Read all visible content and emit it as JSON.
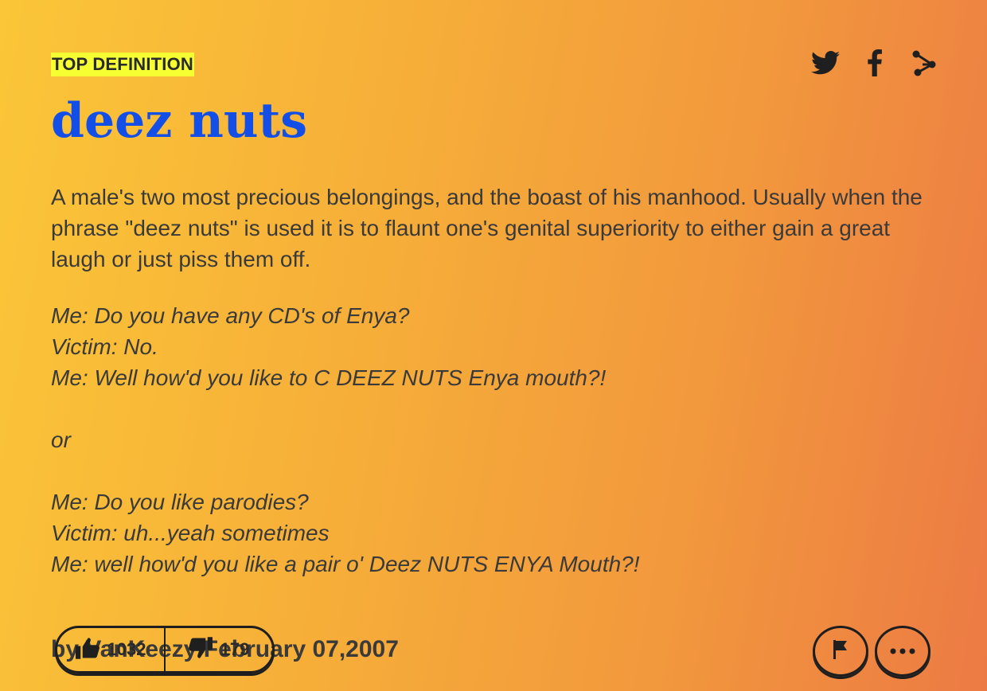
{
  "entry": {
    "badge": "TOP DEFINITION",
    "word": "deez nuts",
    "meaning": "A male's two most precious belongings, and the boast of his manhood. Usually when the phrase \"deez nuts\" is used it is to flaunt one's genital superiority to either gain a great laugh or just piss them off.",
    "example_lines": [
      "Me: Do you have any CD's of Enya?",
      "Victim: No.",
      "Me: Well how'd you like to C DEEZ NUTS Enya mouth?!",
      "",
      "or",
      "",
      "Me: Do you like parodies?",
      "Victim: uh...yeah sometimes",
      "Me: well how'd you like a pair o' Deez NUTS ENYA Mouth?!"
    ],
    "contributor": "by VanKeezy February 07,2007",
    "upvotes": "1032",
    "downvotes": "179"
  },
  "share": {
    "icons": [
      "twitter-icon",
      "facebook-icon",
      "share-icon"
    ]
  },
  "actions": {
    "icons": [
      "flag-icon",
      "more-icon"
    ]
  },
  "colors": {
    "word": "#134fe6",
    "badge_bg": "#f5ff32",
    "text": "#3a3a3a",
    "gradient_start": "#fbc638",
    "gradient_end": "#ec7a44"
  }
}
